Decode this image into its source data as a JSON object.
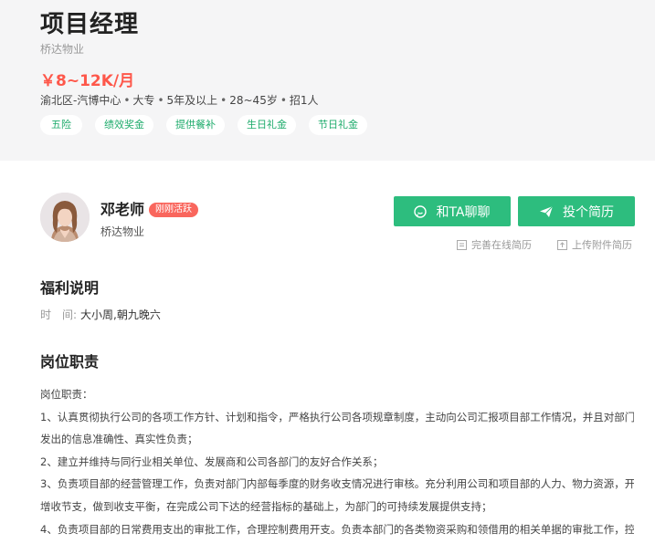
{
  "job": {
    "title": "项目经理",
    "company": "桥达物业",
    "salary": "￥8~12K/月",
    "meta": [
      "渝北区-汽博中心",
      "大专",
      "5年及以上",
      "28~45岁",
      "招1人"
    ],
    "tags": [
      "五险",
      "绩效奖金",
      "提供餐补",
      "生日礼金",
      "节日礼金"
    ]
  },
  "recruiter": {
    "name": "邓老师",
    "badge": "刚刚活跃",
    "company": "桥达物业"
  },
  "actions": {
    "chat_label": "和TA聊聊",
    "apply_label": "投个简历",
    "online_resume": "完善在线简历",
    "upload_resume": "上传附件简历"
  },
  "welfare": {
    "title": "福利说明",
    "time_label": "时　间:",
    "time_value": "大小周,朝九晚六"
  },
  "duties": {
    "title": "岗位职责",
    "lines": [
      "岗位职责：",
      "1、认真贯彻执行公司的各项工作方针、计划和指令，严格执行公司各项规章制度，主动向公司汇报项目部工作情况，并且对部门所",
      "发出的信息准确性、真实性负责；",
      "2、建立并维持与同行业相关单位、发展商和公司各部门的友好合作关系；",
      "3、负责项目部的经营管理工作，负责对部门内部每季度的财务收支情况进行审核。充分利用公司和项目部的人力、物力资源，开展",
      "增收节支，做到收支平衡，在完成公司下达的经营指标的基础上，为部门的可持续发展提供支持；",
      "4、负责项目部的日常费用支出的审批工作，合理控制费用开支。负责本部门的各类物资采购和领借用的相关单据的审批工作，控制"
    ]
  },
  "colors": {
    "accent_green": "#2dbd7e",
    "salary_red": "#fe574a",
    "badge_red": "#f9665d",
    "header_bg": "#f5f5f6"
  }
}
